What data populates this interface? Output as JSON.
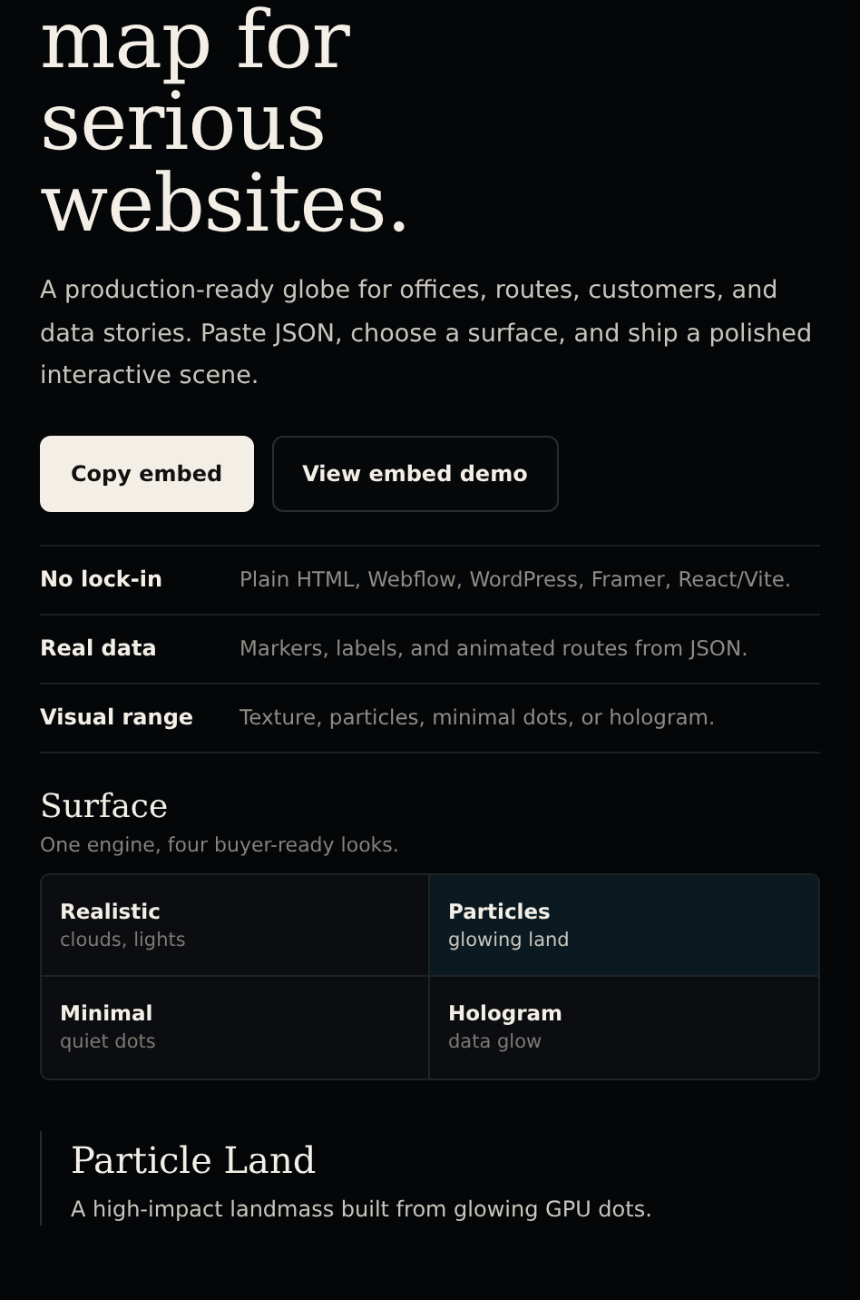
{
  "hero": {
    "headline_lines": [
      "map for",
      "serious",
      "websites."
    ],
    "description": "A production-ready globe for offices, routes, customers, and data stories. Paste JSON, choose a surface, and ship a polished interactive scene.",
    "buttons": [
      {
        "label": "Copy embed",
        "kind": "primary"
      },
      {
        "label": "View embed demo",
        "kind": "secondary"
      }
    ]
  },
  "features": [
    {
      "title": "No lock-in",
      "text": "Plain HTML, Webflow, WordPress, Framer, React/Vite."
    },
    {
      "title": "Real data",
      "text": "Markers, labels, and animated routes from JSON."
    },
    {
      "title": "Visual range",
      "text": "Texture, particles, minimal dots, or hologram."
    }
  ],
  "surface": {
    "heading": "Surface",
    "subtitle": "One engine, four buyer-ready looks.",
    "options": [
      {
        "name": "Realistic",
        "detail": "clouds, lights",
        "selected": false
      },
      {
        "name": "Particles",
        "detail": "glowing land",
        "selected": true
      },
      {
        "name": "Minimal",
        "detail": "quiet dots",
        "selected": false
      },
      {
        "name": "Hologram",
        "detail": "data glow",
        "selected": false
      }
    ]
  },
  "detail": {
    "title": "Particle Land",
    "text": "A high-impact landmass built from glowing GPU dots."
  }
}
